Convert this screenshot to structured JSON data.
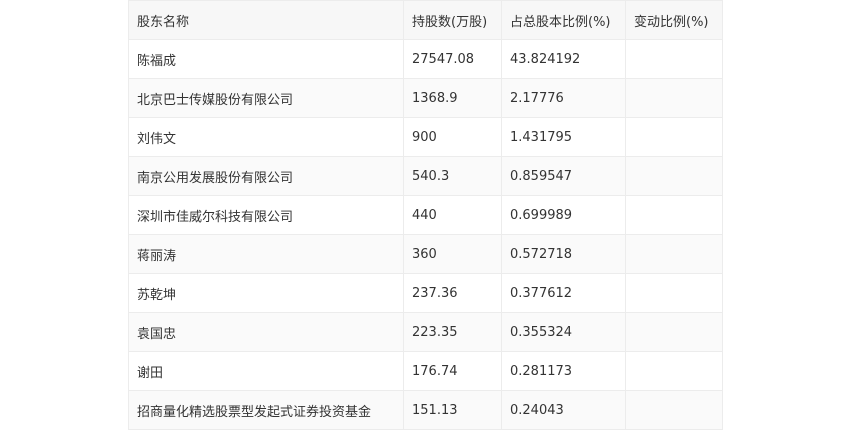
{
  "table": {
    "headers": [
      "股东名称",
      "持股数(万股)",
      "占总股本比例(%)",
      "变动比例(%)"
    ],
    "rows": [
      [
        "陈福成",
        "27547.08",
        "43.824192",
        ""
      ],
      [
        "北京巴士传媒股份有限公司",
        "1368.9",
        "2.17776",
        ""
      ],
      [
        "刘伟文",
        "900",
        "1.431795",
        ""
      ],
      [
        "南京公用发展股份有限公司",
        "540.3",
        "0.859547",
        ""
      ],
      [
        "深圳市佳威尔科技有限公司",
        "440",
        "0.699989",
        ""
      ],
      [
        "蒋丽涛",
        "360",
        "0.572718",
        ""
      ],
      [
        "苏乾坤",
        "237.36",
        "0.377612",
        ""
      ],
      [
        "袁国忠",
        "223.35",
        "0.355324",
        ""
      ],
      [
        "谢田",
        "176.74",
        "0.281173",
        ""
      ],
      [
        "招商量化精选股票型发起式证券投资基金",
        "151.13",
        "0.24043",
        ""
      ]
    ]
  }
}
